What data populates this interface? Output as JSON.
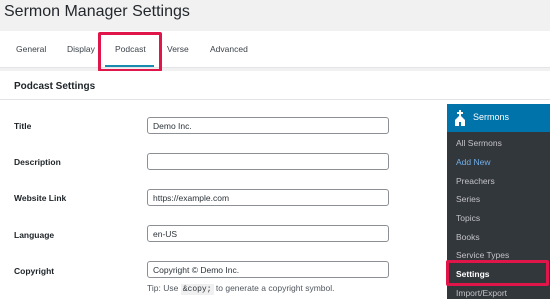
{
  "page": {
    "title": "Sermon Manager Settings"
  },
  "tabs": [
    {
      "label": "General"
    },
    {
      "label": "Display"
    },
    {
      "label": "Podcast"
    },
    {
      "label": "Verse"
    },
    {
      "label": "Advanced"
    }
  ],
  "active_tab": "Podcast",
  "section": {
    "title": "Podcast Settings"
  },
  "fields": {
    "title": {
      "label": "Title",
      "value": "Demo Inc."
    },
    "description": {
      "label": "Description",
      "value": ""
    },
    "website_link": {
      "label": "Website Link",
      "value": "https://example.com"
    },
    "language": {
      "label": "Language",
      "value": "en-US"
    },
    "copyright": {
      "label": "Copyright",
      "value": "Copyright © Demo Inc."
    }
  },
  "tip": {
    "prefix": "Tip: Use",
    "code": "&copy;",
    "suffix": "to generate a copyright symbol."
  },
  "admin_menu": {
    "header": "Sermons",
    "items": [
      {
        "label": "All Sermons"
      },
      {
        "label": "Add New"
      },
      {
        "label": "Preachers"
      },
      {
        "label": "Series"
      },
      {
        "label": "Topics"
      },
      {
        "label": "Books"
      },
      {
        "label": "Service Types"
      },
      {
        "label": "Settings"
      },
      {
        "label": "Import/Export"
      }
    ]
  },
  "colors": {
    "highlight": "#e0164a",
    "menu_accent": "#0073aa",
    "menu_background": "#23282d",
    "active_tab_underline": "#1a8bb0"
  }
}
